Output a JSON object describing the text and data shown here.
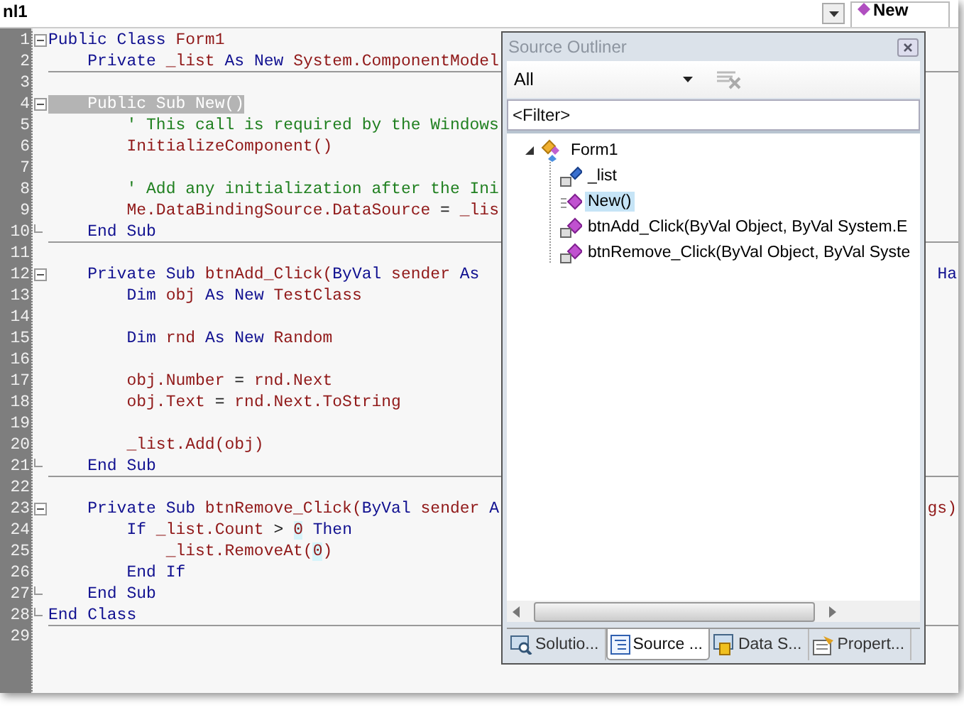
{
  "top_bar": {
    "file_combo": "nl1",
    "member_combo": "New"
  },
  "code_lines": [
    {
      "number": "1",
      "collapsible": true,
      "block_end": false,
      "separator": false,
      "segments": [
        {
          "kind": "keyword",
          "text": "Public Class "
        },
        {
          "kind": "identifier",
          "text": "Form1"
        }
      ]
    },
    {
      "number": "2",
      "collapsible": false,
      "block_end": false,
      "separator": true,
      "segments": [
        {
          "kind": "keyword",
          "text": "    Private "
        },
        {
          "kind": "identifier",
          "text": "_list"
        },
        {
          "kind": "keyword",
          "text": " As New "
        },
        {
          "kind": "identifier",
          "text": "System.ComponentModel"
        }
      ]
    },
    {
      "number": "3",
      "collapsible": false,
      "block_end": false,
      "separator": false
    },
    {
      "number": "4",
      "collapsible": true,
      "block_end": false,
      "separator": false,
      "segments": [
        {
          "kind": "highlight",
          "text": "    Public Sub New()"
        }
      ]
    },
    {
      "number": "5",
      "collapsible": false,
      "block_end": false,
      "separator": false,
      "segments": [
        {
          "kind": "comment",
          "text": "        ' This call is required by the Windows"
        }
      ]
    },
    {
      "number": "6",
      "collapsible": false,
      "block_end": false,
      "separator": false,
      "segments": [
        {
          "kind": "identifier",
          "text": "        InitializeComponent()"
        }
      ]
    },
    {
      "number": "7",
      "collapsible": false,
      "block_end": false,
      "separator": false
    },
    {
      "number": "8",
      "collapsible": false,
      "block_end": false,
      "separator": false,
      "segments": [
        {
          "kind": "comment",
          "text": "        ' Add any initialization after the Ini"
        }
      ]
    },
    {
      "number": "9",
      "collapsible": false,
      "block_end": false,
      "separator": false,
      "segments": [
        {
          "kind": "identifier",
          "text": "        Me.DataBindingSource.DataSource"
        },
        {
          "kind": "plain",
          "text": " = "
        },
        {
          "kind": "identifier",
          "text": "_lis"
        }
      ]
    },
    {
      "number": "10",
      "collapsible": false,
      "block_end": true,
      "separator": true,
      "segments": [
        {
          "kind": "keyword",
          "text": "    End Sub"
        }
      ]
    },
    {
      "number": "11",
      "collapsible": false,
      "block_end": false,
      "separator": false
    },
    {
      "number": "12",
      "collapsible": true,
      "block_end": false,
      "separator": false,
      "segments": [
        {
          "kind": "keyword",
          "text": "    Private Sub "
        },
        {
          "kind": "identifier",
          "text": "btnAdd_Click("
        },
        {
          "kind": "keyword",
          "text": "ByVal"
        },
        {
          "kind": "identifier",
          "text": " sender "
        },
        {
          "kind": "keyword",
          "text": "As"
        }
      ],
      "tail": {
        "kind": "keyword",
        "text": "Ha"
      }
    },
    {
      "number": "13",
      "collapsible": false,
      "block_end": false,
      "separator": false,
      "segments": [
        {
          "kind": "keyword",
          "text": "        Dim "
        },
        {
          "kind": "identifier",
          "text": "obj"
        },
        {
          "kind": "keyword",
          "text": " As New "
        },
        {
          "kind": "identifier",
          "text": "TestClass"
        }
      ]
    },
    {
      "number": "14",
      "collapsible": false,
      "block_end": false,
      "separator": false
    },
    {
      "number": "15",
      "collapsible": false,
      "block_end": false,
      "separator": false,
      "segments": [
        {
          "kind": "keyword",
          "text": "        Dim "
        },
        {
          "kind": "identifier",
          "text": "rnd"
        },
        {
          "kind": "keyword",
          "text": " As New "
        },
        {
          "kind": "identifier",
          "text": "Random"
        }
      ]
    },
    {
      "number": "16",
      "collapsible": false,
      "block_end": false,
      "separator": false
    },
    {
      "number": "17",
      "collapsible": false,
      "block_end": false,
      "separator": false,
      "segments": [
        {
          "kind": "identifier",
          "text": "        obj.Number"
        },
        {
          "kind": "plain",
          "text": " = "
        },
        {
          "kind": "identifier",
          "text": "rnd.Next"
        }
      ]
    },
    {
      "number": "18",
      "collapsible": false,
      "block_end": false,
      "separator": false,
      "segments": [
        {
          "kind": "identifier",
          "text": "        obj.Text"
        },
        {
          "kind": "plain",
          "text": " = "
        },
        {
          "kind": "identifier",
          "text": "rnd.Next.ToString"
        }
      ]
    },
    {
      "number": "19",
      "collapsible": false,
      "block_end": false,
      "separator": false
    },
    {
      "number": "20",
      "collapsible": false,
      "block_end": false,
      "separator": false,
      "segments": [
        {
          "kind": "identifier",
          "text": "        _list.Add(obj)"
        }
      ]
    },
    {
      "number": "21",
      "collapsible": false,
      "block_end": true,
      "separator": true,
      "segments": [
        {
          "kind": "keyword",
          "text": "    End Sub"
        }
      ]
    },
    {
      "number": "22",
      "collapsible": false,
      "block_end": false,
      "separator": false
    },
    {
      "number": "23",
      "collapsible": true,
      "block_end": false,
      "separator": false,
      "segments": [
        {
          "kind": "keyword",
          "text": "    Private Sub "
        },
        {
          "kind": "identifier",
          "text": "btnRemove_Click("
        },
        {
          "kind": "keyword",
          "text": "ByVal"
        },
        {
          "kind": "identifier",
          "text": " sender "
        },
        {
          "kind": "keyword",
          "text": "A"
        }
      ],
      "tail": {
        "kind": "identifier",
        "text": "gs)"
      }
    },
    {
      "number": "24",
      "collapsible": false,
      "block_end": false,
      "separator": false,
      "segments": [
        {
          "kind": "keyword",
          "text": "        If "
        },
        {
          "kind": "identifier",
          "text": "_list.Count"
        },
        {
          "kind": "plain",
          "text": " > "
        },
        {
          "kind": "match",
          "text": "0"
        },
        {
          "kind": "keyword",
          "text": " Then"
        }
      ]
    },
    {
      "number": "25",
      "collapsible": false,
      "block_end": false,
      "separator": false,
      "segments": [
        {
          "kind": "identifier",
          "text": "            _list.RemoveAt("
        },
        {
          "kind": "match",
          "text": "0"
        },
        {
          "kind": "identifier",
          "text": ")"
        }
      ]
    },
    {
      "number": "26",
      "collapsible": false,
      "block_end": false,
      "separator": false,
      "segments": [
        {
          "kind": "keyword",
          "text": "        End If"
        }
      ]
    },
    {
      "number": "27",
      "collapsible": false,
      "block_end": true,
      "separator": false,
      "segments": [
        {
          "kind": "keyword",
          "text": "    End Sub"
        }
      ]
    },
    {
      "number": "28",
      "collapsible": false,
      "block_end": true,
      "separator": true,
      "segments": [
        {
          "kind": "keyword",
          "text": "End Class"
        }
      ]
    },
    {
      "number": "29",
      "collapsible": false,
      "block_end": false,
      "separator": false
    }
  ],
  "outliner": {
    "title": "Source Outliner",
    "scope_combo": "All",
    "filter": {
      "placeholder": "<Filter>"
    },
    "tree": [
      {
        "label": "Form1",
        "kind": "class",
        "expanded": true,
        "selected": false,
        "children": [
          {
            "label": "_list",
            "kind": "field",
            "selected": false
          },
          {
            "label": "New()",
            "kind": "method",
            "selected": true
          },
          {
            "label": "btnAdd_Click(ByVal Object, ByVal System.E",
            "kind": "private-method",
            "selected": false
          },
          {
            "label": "btnRemove_Click(ByVal Object, ByVal Syste",
            "kind": "private-method",
            "selected": false
          }
        ]
      }
    ],
    "tabs": [
      {
        "label": "Solutio...",
        "kind": "solution",
        "selected": false
      },
      {
        "label": "Source ...",
        "kind": "source",
        "selected": true
      },
      {
        "label": "Data S...",
        "kind": "data",
        "selected": false
      },
      {
        "label": "Propert...",
        "kind": "properties",
        "selected": false
      }
    ]
  }
}
